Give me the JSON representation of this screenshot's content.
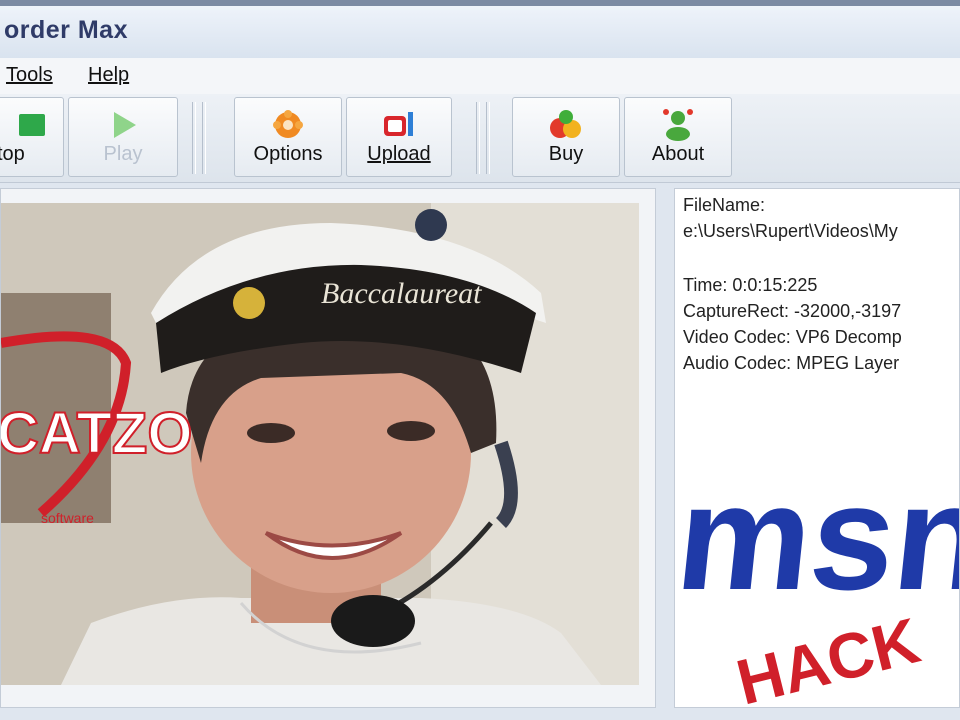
{
  "app": {
    "title": "order Max"
  },
  "menu": [
    {
      "label": "Tools"
    },
    {
      "label": "Help"
    }
  ],
  "toolbar": {
    "stop_label": "top",
    "play_label": "Play",
    "options_label": "Options",
    "upload_label": "Upload",
    "buy_label": "Buy",
    "about_label": "About"
  },
  "video": {
    "logo_text": "CATZO",
    "logo_sub": "software",
    "cap_text": "Baccalaureat"
  },
  "info": {
    "filename_label": "FileName:",
    "filename_value": "e:\\Users\\Rupert\\Videos\\My",
    "time": "Time: 0:0:15:225",
    "capture_rect": "CaptureRect: -32000,-3197",
    "video_codec": "Video Codec: VP6 Decomp",
    "audio_codec": "Audio Codec: MPEG Layer",
    "msn_text": "msn",
    "hack_text": "HACK"
  },
  "colors": {
    "title": "#2f3b68",
    "msn_blue": "#1f3aa8",
    "hack_red": "#d0202a"
  }
}
